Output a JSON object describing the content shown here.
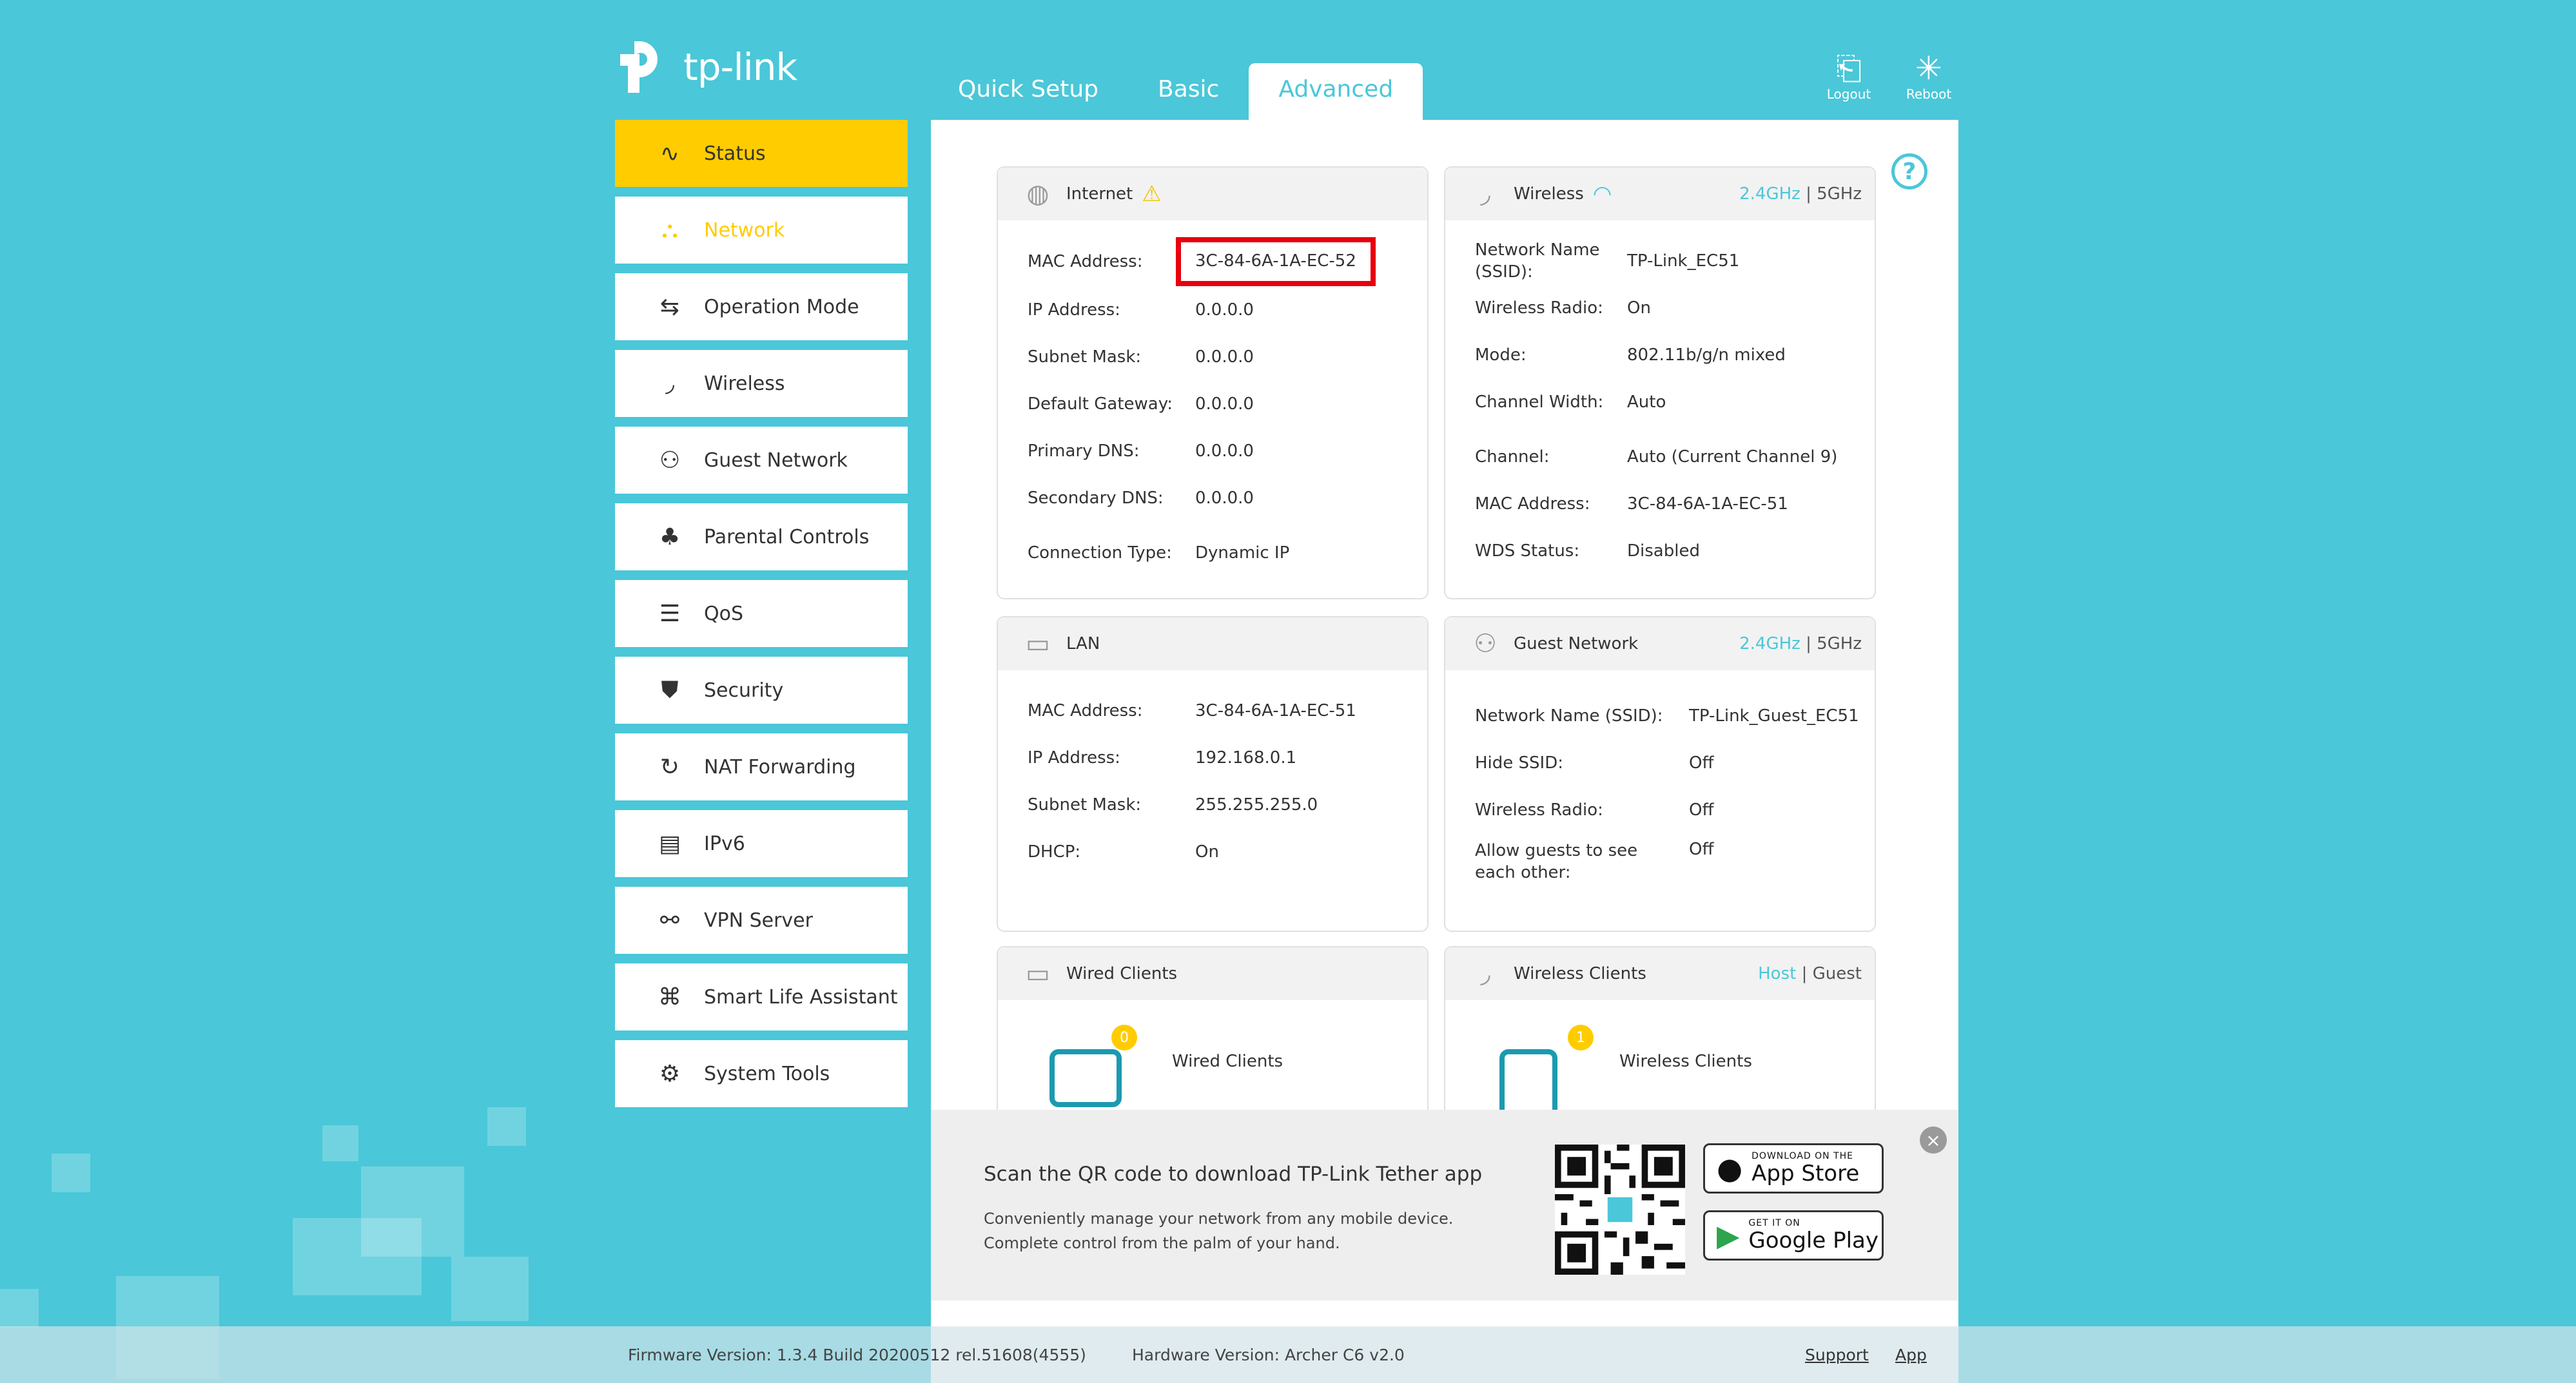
{
  "brand": {
    "logo_text": "tp-link"
  },
  "top_tabs": [
    {
      "label": "Quick Setup",
      "active": false
    },
    {
      "label": "Basic",
      "active": false
    },
    {
      "label": "Advanced",
      "active": true
    }
  ],
  "top_actions": {
    "logout": "Logout",
    "reboot": "Reboot"
  },
  "sidebar": {
    "items": [
      {
        "label": "Status",
        "icon": "pulse-icon"
      },
      {
        "label": "Network",
        "icon": "network-icon"
      },
      {
        "label": "Operation Mode",
        "icon": "operation-mode-icon"
      },
      {
        "label": "Wireless",
        "icon": "wireless-icon"
      },
      {
        "label": "Guest Network",
        "icon": "guest-icon"
      },
      {
        "label": "Parental Controls",
        "icon": "parental-icon"
      },
      {
        "label": "QoS",
        "icon": "qos-icon"
      },
      {
        "label": "Security",
        "icon": "shield-icon"
      },
      {
        "label": "NAT Forwarding",
        "icon": "nat-icon"
      },
      {
        "label": "IPv6",
        "icon": "ipv6-icon"
      },
      {
        "label": "VPN Server",
        "icon": "vpn-icon"
      },
      {
        "label": "Smart Life Assistant",
        "icon": "smart-life-icon"
      },
      {
        "label": "System Tools",
        "icon": "gear-icon"
      }
    ]
  },
  "internet": {
    "title": "Internet",
    "rows": [
      {
        "label": "MAC Address:",
        "value": "3C-84-6A-1A-EC-52"
      },
      {
        "label": "IP Address:",
        "value": "0.0.0.0"
      },
      {
        "label": "Subnet Mask:",
        "value": "0.0.0.0"
      },
      {
        "label": "Default Gateway:",
        "value": "0.0.0.0"
      },
      {
        "label": "Primary DNS:",
        "value": "0.0.0.0"
      },
      {
        "label": "Secondary DNS:",
        "value": "0.0.0.0"
      },
      {
        "label": "Connection Type:",
        "value": "Dynamic IP"
      }
    ]
  },
  "wireless": {
    "title": "Wireless",
    "band_24": "2.4GHz",
    "sep": "|",
    "band_5": "5GHz",
    "rows": [
      {
        "label": "Network Name (SSID):",
        "value": "TP-Link_EC51"
      },
      {
        "label": "Wireless Radio:",
        "value": "On"
      },
      {
        "label": "Mode:",
        "value": "802.11b/g/n mixed"
      },
      {
        "label": "Channel Width:",
        "value": "Auto"
      },
      {
        "label": "Channel:",
        "value": "Auto (Current Channel 9)"
      },
      {
        "label": "MAC Address:",
        "value": "3C-84-6A-1A-EC-51"
      },
      {
        "label": "WDS Status:",
        "value": "Disabled"
      }
    ]
  },
  "lan": {
    "title": "LAN",
    "rows": [
      {
        "label": "MAC Address:",
        "value": "3C-84-6A-1A-EC-51"
      },
      {
        "label": "IP Address:",
        "value": "192.168.0.1"
      },
      {
        "label": "Subnet Mask:",
        "value": "255.255.255.0"
      },
      {
        "label": "DHCP:",
        "value": "On"
      }
    ]
  },
  "guest_network": {
    "title": "Guest Network",
    "band_24": "2.4GHz",
    "sep": "|",
    "band_5": "5GHz",
    "rows": [
      {
        "label": "Network Name (SSID):",
        "value": "TP-Link_Guest_EC51"
      },
      {
        "label": "Hide SSID:",
        "value": "Off"
      },
      {
        "label": "Wireless Radio:",
        "value": "Off"
      },
      {
        "label": "Allow guests to see each other:",
        "value": "Off"
      }
    ]
  },
  "wired_clients": {
    "title": "Wired Clients",
    "count": "0",
    "label": "Wired Clients"
  },
  "wireless_clients": {
    "title": "Wireless Clients",
    "host": "Host",
    "sep": "|",
    "guest": "Guest",
    "count": "1",
    "label": "Wireless Clients"
  },
  "qr_banner": {
    "title": "Scan the QR code to download TP-Link Tether app",
    "desc_line1": "Conveniently manage your network from any mobile device.",
    "desc_line2": "Complete control from the palm of your hand.",
    "app_store_small": "DOWNLOAD ON THE",
    "app_store_big": "App Store",
    "google_small": "GET IT ON",
    "google_big": "Google Play"
  },
  "footer": {
    "firmware": "Firmware Version: 1.3.4 Build 20200512 rel.51608(4555)",
    "hardware": "Hardware Version: Archer C6 v2.0",
    "support": "Support",
    "app": "App"
  },
  "colors": {
    "accent": "#4ac7d8",
    "active": "#ffcc00",
    "highlight": "#e8000d"
  }
}
